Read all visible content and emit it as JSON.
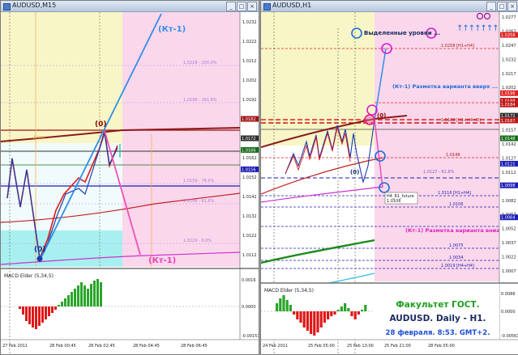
{
  "windows": [
    {
      "title": "AUDUSD,M15",
      "price_ticks": [
        "1.0232",
        "1.0222",
        "1.0212",
        "1.0202",
        "1.0192",
        "1.0182",
        "1.0172",
        "1.0162",
        "1.0152",
        "1.0142",
        "1.0132",
        "1.0122",
        "1.0112"
      ],
      "price_badges": [
        "1.0182",
        "1.0172",
        "1.0166",
        "1.0156"
      ],
      "time_labels": [
        "27 Feb 2011",
        "28 Feb 00:45",
        "28 Feb 02:45",
        "28 Feb 04:45",
        "28 Feb 06:45"
      ],
      "labels": {
        "kt1_top": "(Кт-1)",
        "kt1_bottom": "(Кт-1)",
        "zero_top": "(0)",
        "zero_bottom": "(0)",
        "area": "Area",
        "lvl1": "1.0218 - 200.0%",
        "lvl2": "1.0196 - 161.8%",
        "lvl3": "1.0156 - 78.6%",
        "lvl4": "1.0148 - 61.8%",
        "lvl5": "1.0120 - 0.0%"
      },
      "indicator": {
        "name": "MACD Elder (5,34,5)",
        "ticks": [
          "0.0016",
          "0.0000",
          "-0.00157"
        ]
      }
    },
    {
      "title": "AUDUSD,H1",
      "price_ticks": [
        "1.0277",
        "1.0262",
        "1.0247",
        "1.0232",
        "1.0217",
        "1.0202",
        "1.0187",
        "1.0172",
        "1.0157",
        "1.0142",
        "1.0127",
        "1.0112",
        "1.0097",
        "1.0082",
        "1.0067",
        "1.0052",
        "1.0037",
        "1.0022",
        "1.0007"
      ],
      "price_badges": [
        "1.0258",
        "1.0196",
        "1.0188",
        "1.0184",
        "1.0172",
        "1.0167",
        "1.0148",
        "1.0121",
        "1.0098",
        "1.0064"
      ],
      "time_labels": [
        "24 Feb 2011",
        "25 Feb 05:00",
        "25 Feb 13:00",
        "25 Feb 21:00",
        "28 Feb 05:00"
      ],
      "labels": {
        "highlighted_levels": "Выделенные уровни ...",
        "kt1_up": "(Кт-1) Разметка варианта вверх ...",
        "kt1_down": "(Кт-1) Разметка варианта вниз ...",
        "zero": "(0)",
        "zero_small": "(0)",
        "future_label": "H4_R1_future",
        "future_value": "1.0106",
        "lvl_258": "1.0258 [H1+H4]",
        "lvl_188": "1.0188 [H1+H4+D]",
        "lvl_148": "1.0148",
        "lvl_127": "1.0127 - 61.8%",
        "lvl_116": "1.0116 [H1+H4]",
        "lvl_106": "1.0106",
        "lvl_075": "1.0075",
        "lvl_034": "1.0034",
        "lvl_019": "1.0019 [H4+H4]"
      },
      "indicator": {
        "name": "MACD Elder (5,34,5)",
        "ticks": [
          "0.0086",
          "0.0000",
          "-0.00563"
        ]
      },
      "caption": {
        "line1": "Факультет ГОСТ.",
        "line2": "AUDUSD. Daily - H1.",
        "line3": "28 февраля. 8:53. GMT+2."
      },
      "colors": {
        "caption_green": "#1c9e1c",
        "caption_blue": "#1d4fd8",
        "caption_dark": "#1d2b60"
      }
    }
  ]
}
